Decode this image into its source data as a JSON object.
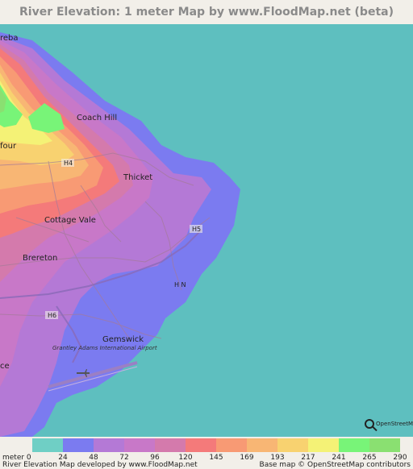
{
  "title": "River Elevation: 1 meter Map by www.FloodMap.net (beta)",
  "map": {
    "places": {
      "top_left": "reba",
      "coach_hill": "Coach Hill",
      "left_mid": "four",
      "thicket": "Thicket",
      "cottage_vale": "Cottage Vale",
      "brereton": "Brereton",
      "gemswick": "Gemswick",
      "bottom_left": "ce",
      "airport": "Grantley Adams International Airport"
    },
    "roads": {
      "h4": "H4",
      "h5": "H5",
      "hn": "H N",
      "h6": "H6"
    },
    "attribution_logo": "OpenStreetMap"
  },
  "legend": {
    "unit_label": "meter",
    "ticks": [
      "0",
      "24",
      "48",
      "72",
      "96",
      "120",
      "145",
      "169",
      "193",
      "217",
      "241",
      "265",
      "290"
    ],
    "colors": [
      "#6fcfc5",
      "#7b7bf0",
      "#b479d6",
      "#c878c8",
      "#d47aac",
      "#f47a7a",
      "#f89a74",
      "#f8b674",
      "#f8d270",
      "#f4f276",
      "#78f478",
      "#8ae071"
    ]
  },
  "footer": {
    "left": "River Elevation Map developed by www.FloodMap.net",
    "right": "Base map © OpenStreetMap contributors"
  }
}
